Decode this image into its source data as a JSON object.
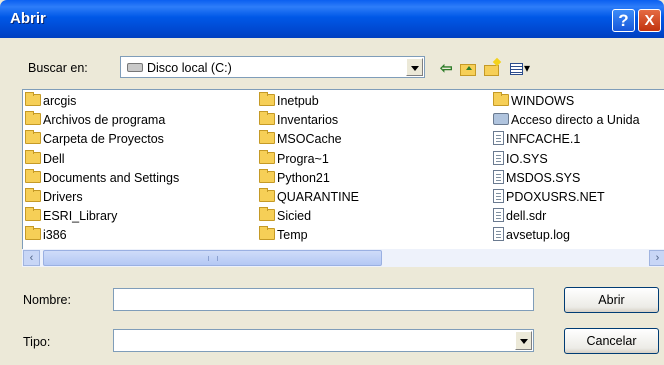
{
  "window": {
    "title": "Abrir",
    "help_label": "?",
    "close_label": "X"
  },
  "lookin": {
    "label": "Buscar en:",
    "value": "Disco local (C:)",
    "value_icon": "drive-icon"
  },
  "toolbar": {
    "back_icon": "⇦",
    "view_menu_icon": "▾"
  },
  "files": [
    {
      "name": "arcgis",
      "icon": "folder-icon"
    },
    {
      "name": "Archivos de programa",
      "icon": "folder-icon"
    },
    {
      "name": "Carpeta de Proyectos",
      "icon": "folder-icon"
    },
    {
      "name": "Dell",
      "icon": "folder-icon"
    },
    {
      "name": "Documents and Settings",
      "icon": "folder-icon"
    },
    {
      "name": "Drivers",
      "icon": "folder-icon"
    },
    {
      "name": "ESRI_Library",
      "icon": "folder-icon"
    },
    {
      "name": "i386",
      "icon": "folder-icon"
    },
    {
      "name": "Inetpub",
      "icon": "folder-icon"
    },
    {
      "name": "Inventarios",
      "icon": "folder-icon"
    },
    {
      "name": "MSOCache",
      "icon": "folder-icon"
    },
    {
      "name": "Progra~1",
      "icon": "folder-icon"
    },
    {
      "name": "Python21",
      "icon": "folder-icon"
    },
    {
      "name": "QUARANTINE",
      "icon": "folder-icon"
    },
    {
      "name": "Sicied",
      "icon": "folder-icon"
    },
    {
      "name": "Temp",
      "icon": "folder-icon"
    },
    {
      "name": "WINDOWS",
      "icon": "folder-icon"
    },
    {
      "name": "Acceso directo a Unida",
      "icon": "shortcut-icon"
    },
    {
      "name": "INFCACHE.1",
      "icon": "file-icon"
    },
    {
      "name": "IO.SYS",
      "icon": "file-icon"
    },
    {
      "name": "MSDOS.SYS",
      "icon": "file-icon"
    },
    {
      "name": "PDOXUSRS.NET",
      "icon": "file-icon"
    },
    {
      "name": "dell.sdr",
      "icon": "file-icon"
    },
    {
      "name": "avsetup.log",
      "icon": "file-icon"
    }
  ],
  "scroll": {
    "left_arrow": "‹",
    "right_arrow": "›"
  },
  "filename": {
    "label": "Nombre:",
    "value": ""
  },
  "filetype": {
    "label": "Tipo:",
    "value": ""
  },
  "buttons": {
    "open": "Abrir",
    "cancel": "Cancelar"
  },
  "colors": {
    "titlebar": "#0054e3",
    "dialog": "#ece9d8",
    "folder": "#f6cf57"
  }
}
